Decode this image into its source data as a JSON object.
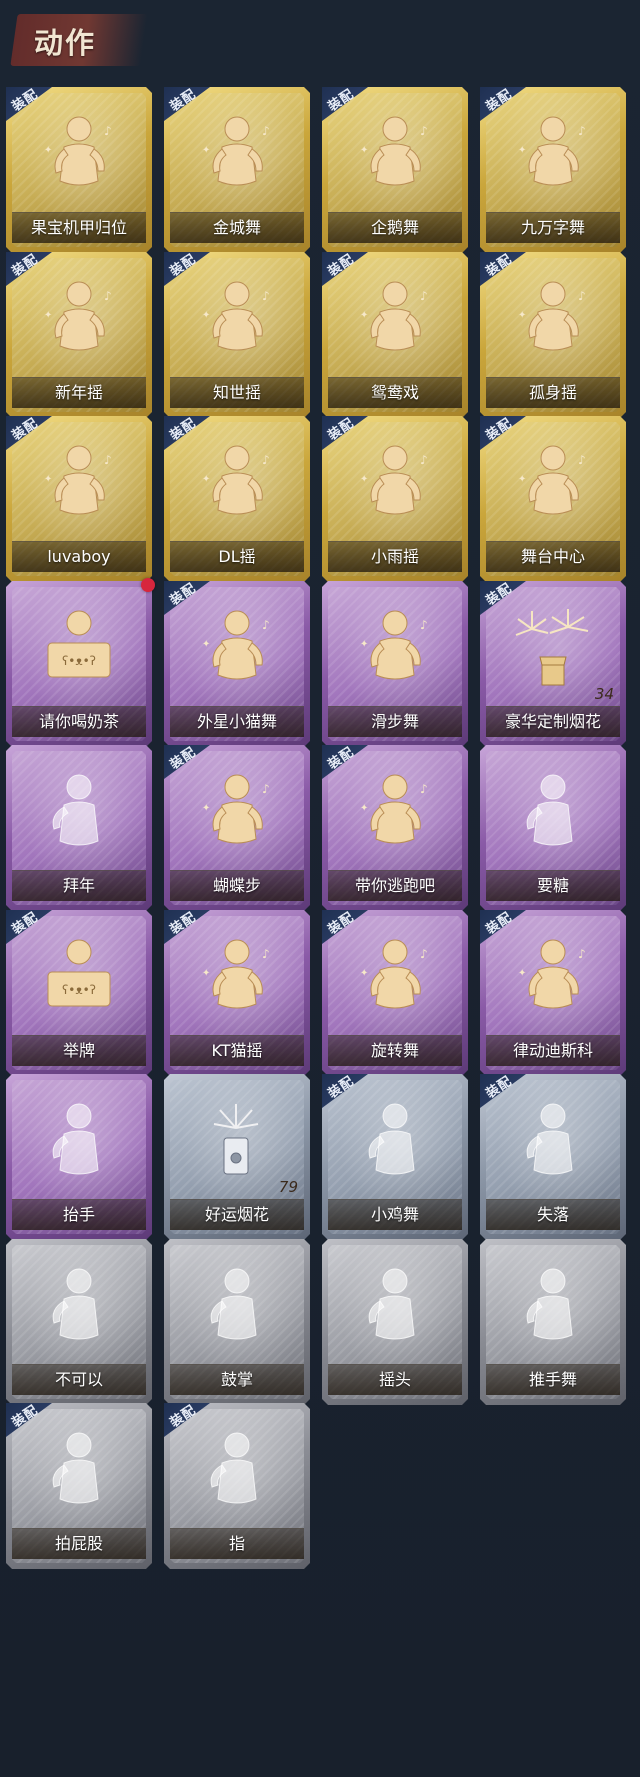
{
  "header": {
    "title": "动作"
  },
  "badge_text": "装配",
  "colors": {
    "gold": "#caa63b",
    "purple": "#8a5aa7",
    "silver": "#8d98a8",
    "gray": "#8b8d95",
    "badge": "#1f3052",
    "notification": "#d7263d"
  },
  "cards": [
    {
      "label": "果宝机甲归位",
      "rarity": "gold",
      "equipped": true,
      "icon": "dance-pose-icon"
    },
    {
      "label": "金城舞",
      "rarity": "gold",
      "equipped": true,
      "icon": "dance-pose-icon"
    },
    {
      "label": "企鹅舞",
      "rarity": "gold",
      "equipped": true,
      "icon": "dance-pose-icon"
    },
    {
      "label": "九万字舞",
      "rarity": "gold",
      "equipped": true,
      "icon": "dance-pose-icon"
    },
    {
      "label": "新年摇",
      "rarity": "gold",
      "equipped": true,
      "icon": "dance-pose-icon"
    },
    {
      "label": "知世摇",
      "rarity": "gold",
      "equipped": true,
      "icon": "dance-pose-icon"
    },
    {
      "label": "鸳鸯戏",
      "rarity": "gold",
      "equipped": true,
      "icon": "dance-pose-icon"
    },
    {
      "label": "孤身摇",
      "rarity": "gold",
      "equipped": true,
      "icon": "dance-pose-icon"
    },
    {
      "label": "luvaboy",
      "rarity": "gold",
      "equipped": true,
      "icon": "dance-pose-icon"
    },
    {
      "label": "DL摇",
      "rarity": "gold",
      "equipped": true,
      "icon": "dance-pose-icon"
    },
    {
      "label": "小雨摇",
      "rarity": "gold",
      "equipped": true,
      "icon": "dance-pose-icon"
    },
    {
      "label": "舞台中心",
      "rarity": "gold",
      "equipped": true,
      "icon": "dance-pose-icon"
    },
    {
      "label": "请你喝奶茶",
      "rarity": "purple",
      "equipped": false,
      "icon": "sign-pose-icon",
      "new_dot": true
    },
    {
      "label": "外星小猫舞",
      "rarity": "purple",
      "equipped": true,
      "icon": "dance-pose-icon"
    },
    {
      "label": "滑步舞",
      "rarity": "purple",
      "equipped": false,
      "icon": "dance-pose-icon"
    },
    {
      "label": "豪华定制烟花",
      "rarity": "purple",
      "equipped": true,
      "icon": "fireworks-box-icon",
      "count": "34"
    },
    {
      "label": "拜年",
      "rarity": "purple",
      "equipped": false,
      "icon": "greeting-pose-icon"
    },
    {
      "label": "蝴蝶步",
      "rarity": "purple",
      "equipped": true,
      "icon": "dance-pose-icon"
    },
    {
      "label": "带你逃跑吧",
      "rarity": "purple",
      "equipped": true,
      "icon": "point-pose-icon"
    },
    {
      "label": "要糖",
      "rarity": "purple",
      "equipped": false,
      "icon": "beg-pose-icon"
    },
    {
      "label": "举牌",
      "rarity": "purple",
      "equipped": true,
      "icon": "sign-pose-icon"
    },
    {
      "label": "KT猫摇",
      "rarity": "purple",
      "equipped": true,
      "icon": "dance-pose-icon"
    },
    {
      "label": "旋转舞",
      "rarity": "purple",
      "equipped": true,
      "icon": "spin-pose-icon"
    },
    {
      "label": "律动迪斯科",
      "rarity": "purple",
      "equipped": true,
      "icon": "disco-pose-icon"
    },
    {
      "label": "抬手",
      "rarity": "purple",
      "equipped": false,
      "icon": "raise-hand-pose-icon"
    },
    {
      "label": "好运烟花",
      "rarity": "silver",
      "equipped": false,
      "icon": "firecracker-icon",
      "count": "79"
    },
    {
      "label": "小鸡舞",
      "rarity": "silver",
      "equipped": true,
      "icon": "chicken-dance-pose-icon"
    },
    {
      "label": "失落",
      "rarity": "silver",
      "equipped": true,
      "icon": "crawl-pose-icon"
    },
    {
      "label": "不可以",
      "rarity": "gray",
      "equipped": false,
      "icon": "finger-wag-icon"
    },
    {
      "label": "鼓掌",
      "rarity": "gray",
      "equipped": false,
      "icon": "clap-hands-icon"
    },
    {
      "label": "摇头",
      "rarity": "gray",
      "equipped": false,
      "icon": "shake-head-pose-icon"
    },
    {
      "label": "推手舞",
      "rarity": "gray",
      "equipped": false,
      "icon": "push-hands-pose-icon"
    },
    {
      "label": "拍屁股",
      "rarity": "gray",
      "equipped": true,
      "icon": "spank-pose-icon"
    },
    {
      "label": "指",
      "rarity": "gray",
      "equipped": true,
      "icon": "point-hand-icon"
    }
  ]
}
